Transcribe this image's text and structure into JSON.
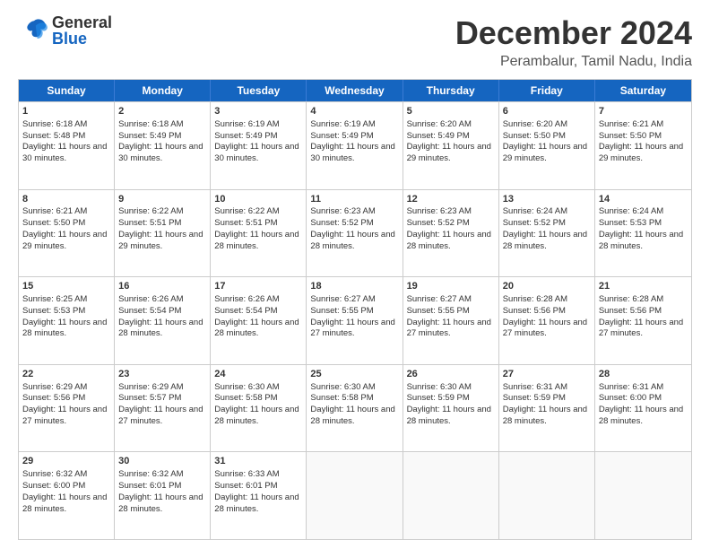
{
  "header": {
    "title": "December 2024",
    "subtitle": "Perambalur, Tamil Nadu, India",
    "logo_general": "General",
    "logo_blue": "Blue"
  },
  "calendar": {
    "days_of_week": [
      "Sunday",
      "Monday",
      "Tuesday",
      "Wednesday",
      "Thursday",
      "Friday",
      "Saturday"
    ],
    "weeks": [
      [
        {
          "day": "",
          "empty": true
        },
        {
          "day": "",
          "empty": true
        },
        {
          "day": "",
          "empty": true
        },
        {
          "day": "",
          "empty": true
        },
        {
          "day": "",
          "empty": true
        },
        {
          "day": "",
          "empty": true
        },
        {
          "day": "",
          "empty": true
        }
      ],
      [
        {
          "num": "1",
          "sunrise": "Sunrise: 6:18 AM",
          "sunset": "Sunset: 5:48 PM",
          "daylight": "Daylight: 11 hours and 30 minutes."
        },
        {
          "num": "2",
          "sunrise": "Sunrise: 6:18 AM",
          "sunset": "Sunset: 5:49 PM",
          "daylight": "Daylight: 11 hours and 30 minutes."
        },
        {
          "num": "3",
          "sunrise": "Sunrise: 6:19 AM",
          "sunset": "Sunset: 5:49 PM",
          "daylight": "Daylight: 11 hours and 30 minutes."
        },
        {
          "num": "4",
          "sunrise": "Sunrise: 6:19 AM",
          "sunset": "Sunset: 5:49 PM",
          "daylight": "Daylight: 11 hours and 30 minutes."
        },
        {
          "num": "5",
          "sunrise": "Sunrise: 6:20 AM",
          "sunset": "Sunset: 5:49 PM",
          "daylight": "Daylight: 11 hours and 29 minutes."
        },
        {
          "num": "6",
          "sunrise": "Sunrise: 6:20 AM",
          "sunset": "Sunset: 5:50 PM",
          "daylight": "Daylight: 11 hours and 29 minutes."
        },
        {
          "num": "7",
          "sunrise": "Sunrise: 6:21 AM",
          "sunset": "Sunset: 5:50 PM",
          "daylight": "Daylight: 11 hours and 29 minutes."
        }
      ],
      [
        {
          "num": "8",
          "sunrise": "Sunrise: 6:21 AM",
          "sunset": "Sunset: 5:50 PM",
          "daylight": "Daylight: 11 hours and 29 minutes."
        },
        {
          "num": "9",
          "sunrise": "Sunrise: 6:22 AM",
          "sunset": "Sunset: 5:51 PM",
          "daylight": "Daylight: 11 hours and 29 minutes."
        },
        {
          "num": "10",
          "sunrise": "Sunrise: 6:22 AM",
          "sunset": "Sunset: 5:51 PM",
          "daylight": "Daylight: 11 hours and 28 minutes."
        },
        {
          "num": "11",
          "sunrise": "Sunrise: 6:23 AM",
          "sunset": "Sunset: 5:52 PM",
          "daylight": "Daylight: 11 hours and 28 minutes."
        },
        {
          "num": "12",
          "sunrise": "Sunrise: 6:23 AM",
          "sunset": "Sunset: 5:52 PM",
          "daylight": "Daylight: 11 hours and 28 minutes."
        },
        {
          "num": "13",
          "sunrise": "Sunrise: 6:24 AM",
          "sunset": "Sunset: 5:52 PM",
          "daylight": "Daylight: 11 hours and 28 minutes."
        },
        {
          "num": "14",
          "sunrise": "Sunrise: 6:24 AM",
          "sunset": "Sunset: 5:53 PM",
          "daylight": "Daylight: 11 hours and 28 minutes."
        }
      ],
      [
        {
          "num": "15",
          "sunrise": "Sunrise: 6:25 AM",
          "sunset": "Sunset: 5:53 PM",
          "daylight": "Daylight: 11 hours and 28 minutes."
        },
        {
          "num": "16",
          "sunrise": "Sunrise: 6:26 AM",
          "sunset": "Sunset: 5:54 PM",
          "daylight": "Daylight: 11 hours and 28 minutes."
        },
        {
          "num": "17",
          "sunrise": "Sunrise: 6:26 AM",
          "sunset": "Sunset: 5:54 PM",
          "daylight": "Daylight: 11 hours and 28 minutes."
        },
        {
          "num": "18",
          "sunrise": "Sunrise: 6:27 AM",
          "sunset": "Sunset: 5:55 PM",
          "daylight": "Daylight: 11 hours and 27 minutes."
        },
        {
          "num": "19",
          "sunrise": "Sunrise: 6:27 AM",
          "sunset": "Sunset: 5:55 PM",
          "daylight": "Daylight: 11 hours and 27 minutes."
        },
        {
          "num": "20",
          "sunrise": "Sunrise: 6:28 AM",
          "sunset": "Sunset: 5:56 PM",
          "daylight": "Daylight: 11 hours and 27 minutes."
        },
        {
          "num": "21",
          "sunrise": "Sunrise: 6:28 AM",
          "sunset": "Sunset: 5:56 PM",
          "daylight": "Daylight: 11 hours and 27 minutes."
        }
      ],
      [
        {
          "num": "22",
          "sunrise": "Sunrise: 6:29 AM",
          "sunset": "Sunset: 5:56 PM",
          "daylight": "Daylight: 11 hours and 27 minutes."
        },
        {
          "num": "23",
          "sunrise": "Sunrise: 6:29 AM",
          "sunset": "Sunset: 5:57 PM",
          "daylight": "Daylight: 11 hours and 27 minutes."
        },
        {
          "num": "24",
          "sunrise": "Sunrise: 6:30 AM",
          "sunset": "Sunset: 5:58 PM",
          "daylight": "Daylight: 11 hours and 28 minutes."
        },
        {
          "num": "25",
          "sunrise": "Sunrise: 6:30 AM",
          "sunset": "Sunset: 5:58 PM",
          "daylight": "Daylight: 11 hours and 28 minutes."
        },
        {
          "num": "26",
          "sunrise": "Sunrise: 6:30 AM",
          "sunset": "Sunset: 5:59 PM",
          "daylight": "Daylight: 11 hours and 28 minutes."
        },
        {
          "num": "27",
          "sunrise": "Sunrise: 6:31 AM",
          "sunset": "Sunset: 5:59 PM",
          "daylight": "Daylight: 11 hours and 28 minutes."
        },
        {
          "num": "28",
          "sunrise": "Sunrise: 6:31 AM",
          "sunset": "Sunset: 6:00 PM",
          "daylight": "Daylight: 11 hours and 28 minutes."
        }
      ],
      [
        {
          "num": "29",
          "sunrise": "Sunrise: 6:32 AM",
          "sunset": "Sunset: 6:00 PM",
          "daylight": "Daylight: 11 hours and 28 minutes."
        },
        {
          "num": "30",
          "sunrise": "Sunrise: 6:32 AM",
          "sunset": "Sunset: 6:01 PM",
          "daylight": "Daylight: 11 hours and 28 minutes."
        },
        {
          "num": "31",
          "sunrise": "Sunrise: 6:33 AM",
          "sunset": "Sunset: 6:01 PM",
          "daylight": "Daylight: 11 hours and 28 minutes."
        },
        {
          "num": "",
          "empty": true
        },
        {
          "num": "",
          "empty": true
        },
        {
          "num": "",
          "empty": true
        },
        {
          "num": "",
          "empty": true
        }
      ]
    ]
  }
}
